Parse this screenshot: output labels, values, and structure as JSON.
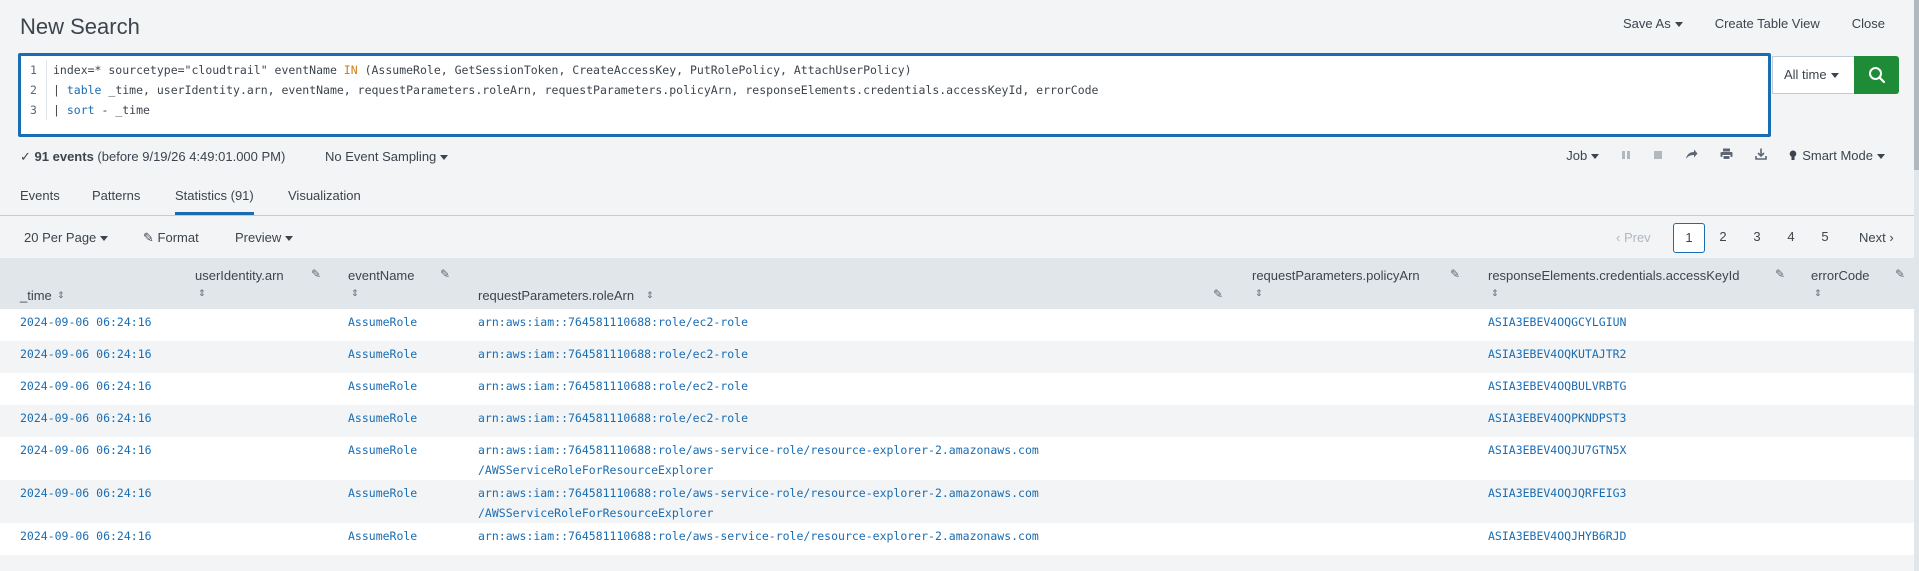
{
  "header": {
    "title": "New Search",
    "save_as": "Save As",
    "create_table_view": "Create Table View",
    "close": "Close"
  },
  "search": {
    "lines": [
      {
        "n": "1",
        "segments": [
          {
            "t": "index=* sourcetype=\"cloudtrail\" eventName ",
            "c": ""
          },
          {
            "t": "IN",
            "c": "kw"
          },
          {
            "t": " (AssumeRole, GetSessionToken, CreateAccessKey, PutRolePolicy, AttachUserPolicy)",
            "c": ""
          }
        ]
      },
      {
        "n": "2",
        "segments": [
          {
            "t": "| ",
            "c": ""
          },
          {
            "t": "table",
            "c": "cmd"
          },
          {
            "t": " _time, userIdentity.arn, eventName, requestParameters.roleArn, requestParameters.policyArn, responseElements.credentials.accessKeyId, errorCode",
            "c": ""
          }
        ]
      },
      {
        "n": "3",
        "segments": [
          {
            "t": "| ",
            "c": ""
          },
          {
            "t": "sort",
            "c": "cmd"
          },
          {
            "t": " - _time",
            "c": ""
          }
        ]
      }
    ],
    "time_range": "All time"
  },
  "status": {
    "check": "✓",
    "count": "91 events",
    "before": "(before 9/19/26 4:49:01.000 PM)",
    "sampling": "No Event Sampling",
    "job": "Job",
    "mode": "Smart Mode"
  },
  "tabs": [
    {
      "label": "Events"
    },
    {
      "label": "Patterns"
    },
    {
      "label": "Statistics (91)"
    },
    {
      "label": "Visualization"
    }
  ],
  "pager": {
    "per_page": "20 Per Page",
    "format": "Format",
    "preview": "Preview",
    "prev": "‹ Prev",
    "pages": [
      "1",
      "2",
      "3",
      "4",
      "5"
    ],
    "next": "Next ›"
  },
  "columns": {
    "time": "_time",
    "user_arn": "userIdentity.arn",
    "event_name": "eventName",
    "role_arn": "requestParameters.roleArn",
    "policy_arn": "requestParameters.policyArn",
    "access_key": "responseElements.credentials.accessKeyId",
    "error_code": "errorCode"
  },
  "rows": [
    {
      "time": "2024-09-06 06:24:16",
      "event": "AssumeRole",
      "role1": "arn:aws:iam::764581110688:role/ec2-role",
      "role2": "",
      "key": "ASIA3EBEV4OQGCYLGIUN"
    },
    {
      "time": "2024-09-06 06:24:16",
      "event": "AssumeRole",
      "role1": "arn:aws:iam::764581110688:role/ec2-role",
      "role2": "",
      "key": "ASIA3EBEV4OQKUTAJTR2"
    },
    {
      "time": "2024-09-06 06:24:16",
      "event": "AssumeRole",
      "role1": "arn:aws:iam::764581110688:role/ec2-role",
      "role2": "",
      "key": "ASIA3EBEV4OQBULVRBTG"
    },
    {
      "time": "2024-09-06 06:24:16",
      "event": "AssumeRole",
      "role1": "arn:aws:iam::764581110688:role/ec2-role",
      "role2": "",
      "key": "ASIA3EBEV4OQPKNDPST3"
    },
    {
      "time": "2024-09-06 06:24:16",
      "event": "AssumeRole",
      "role1": "arn:aws:iam::764581110688:role/aws-service-role/resource-explorer-2.amazonaws.com",
      "role2": "/AWSServiceRoleForResourceExplorer",
      "key": "ASIA3EBEV4OQJU7GTN5X"
    },
    {
      "time": "2024-09-06 06:24:16",
      "event": "AssumeRole",
      "role1": "arn:aws:iam::764581110688:role/aws-service-role/resource-explorer-2.amazonaws.com",
      "role2": "/AWSServiceRoleForResourceExplorer",
      "key": "ASIA3EBEV4OQJQRFEIG3"
    },
    {
      "time": "2024-09-06 06:24:16",
      "event": "AssumeRole",
      "role1": "arn:aws:iam::764581110688:role/aws-service-role/resource-explorer-2.amazonaws.com",
      "role2": "",
      "key": "ASIA3EBEV4OQJHYB6RJD"
    }
  ],
  "colors": {
    "accent": "#1a6db3",
    "search_button": "#1e8c37",
    "keyword": "#c98217"
  }
}
